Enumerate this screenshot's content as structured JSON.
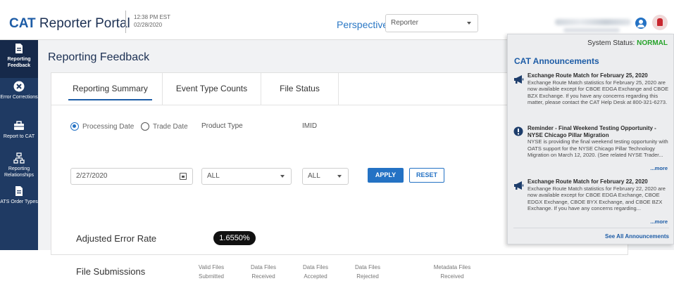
{
  "header": {
    "brand_bold": "CAT",
    "brand_rest": " Reporter Portal",
    "time": "12:38 PM EST",
    "date": "02/28/2020",
    "perspective_label": "Perspective",
    "perspective_value": "Reporter"
  },
  "sidebar": {
    "items": [
      {
        "label": "Reporting Feedback",
        "icon": "document-icon",
        "active": true
      },
      {
        "label": "Error Corrections",
        "icon": "error-x-icon",
        "active": false
      },
      {
        "label": "Report to CAT",
        "icon": "briefcase-icon",
        "active": false
      },
      {
        "label": "Reporting Relationships",
        "icon": "hierarchy-icon",
        "active": false
      },
      {
        "label": "ATS Order Types",
        "icon": "document-icon",
        "active": false
      }
    ]
  },
  "main": {
    "title": "Reporting Feedback",
    "tabs": [
      "Reporting Summary",
      "Event Type Counts",
      "File Status"
    ],
    "radio_processing": "Processing Date",
    "radio_trade": "Trade Date",
    "product_type_label": "Product Type",
    "imid_label": "IMID",
    "date_value": "2/27/2020",
    "product_value": "ALL",
    "imid_value": "ALL",
    "apply": "APPLY",
    "reset": "RESET",
    "aer_label": "Adjusted Error Rate",
    "aer_value": "1.6550%",
    "file_submissions_label": "File Submissions",
    "columns": [
      {
        "line1": "Valid Files",
        "line2": "Submitted"
      },
      {
        "line1": "Data Files",
        "line2": "Received"
      },
      {
        "line1": "Data Files",
        "line2": "Accepted"
      },
      {
        "line1": "Data Files",
        "line2": "Rejected"
      },
      {
        "line1": "Metadata Files",
        "line2": "Received"
      }
    ],
    "partial_col": "Rejected"
  },
  "announcements": {
    "status_label": "System Status:",
    "status_value": "NORMAL",
    "title": "CAT Announcements",
    "items": [
      {
        "icon": "megaphone-icon",
        "heading": "Exchange Route Match for February 25, 2020",
        "body": "Exchange Route Match statistics for February 25, 2020 are now available except for CBOE EDGA Exchange and CBOE BZX Exchange. If you have any concerns regarding this matter, please contact the CAT Help Desk at 800-321-6273.",
        "more": ""
      },
      {
        "icon": "exclamation-icon",
        "heading": "Reminder - Final Weekend Testing Opportunity - NYSE Chicago Pillar Migration",
        "body": "NYSE is providing the final weekend testing opportunity with OATS support for the NYSE Chicago Pillar Technology Migration on March 12, 2020. (See related NYSE Trader...",
        "more": "...more"
      },
      {
        "icon": "megaphone-icon",
        "heading": "Exchange Route Match for February 22, 2020",
        "body": "Exchange Route Match statistics for February 22, 2020 are now available except for CBOE EDGA Exchange, CBOE EDGX Exchange, CBOE BYX Exchange, and CBOE BZX Exchange. If you have any concerns regarding...",
        "more": "...more"
      }
    ],
    "see_all": "See All Announcements"
  },
  "colors": {
    "sidebar": "#1f3a63",
    "accent": "#2472c4",
    "status_ok": "#27a32b",
    "alert": "#c8262e"
  }
}
